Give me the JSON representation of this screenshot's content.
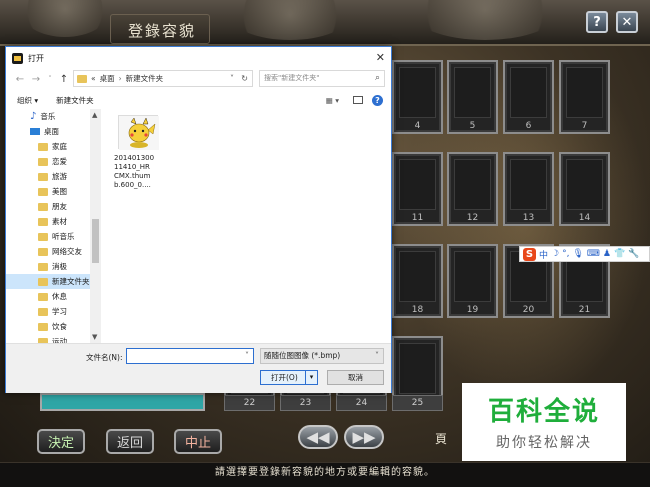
{
  "game": {
    "title": "登錄容貌",
    "help_icon_label": "?",
    "close_icon_label": "✕",
    "slot_numbers": [
      "4",
      "5",
      "6",
      "7",
      "11",
      "12",
      "13",
      "14",
      "18",
      "19",
      "20",
      "21"
    ],
    "bottom_slots": [
      "22",
      "23",
      "24",
      "25"
    ],
    "buttons": {
      "confirm": "決定",
      "back": "返回",
      "cancel": "中止"
    },
    "arrows": {
      "prev": "◀◀",
      "next": "▶▶"
    },
    "page_label": "頁",
    "status": "請選擇要登錄新容貌的地方或要編輯的容貌。"
  },
  "ime": {
    "logo": "S",
    "items": [
      "中",
      "☽",
      "°,",
      "🎙",
      "⌨",
      "♟",
      "👕",
      "🔧"
    ]
  },
  "watermark": {
    "title": "百科全说",
    "subtitle": "助你轻松解决"
  },
  "dialog": {
    "title": "打开",
    "close": "✕",
    "nav": {
      "back": "←",
      "forward": "→",
      "dropdown": "˅",
      "up": "↑"
    },
    "address": {
      "chevrons": "«",
      "crumb1": "桌面",
      "separator": "›",
      "crumb2": "新建文件夹",
      "dropdown": "˅",
      "refresh": "↻"
    },
    "search_placeholder": "搜索\"新建文件夹\"",
    "search_icon": "⌕",
    "toolbar": {
      "organize": "组织 ▾",
      "new_folder": "新建文件夹",
      "view": "▦ ▾",
      "help": "?"
    },
    "nav_items": [
      {
        "label": "音乐",
        "icon": "music"
      },
      {
        "label": "桌面",
        "icon": "desktop"
      },
      {
        "label": "家庭",
        "icon": "folder"
      },
      {
        "label": "恋爱",
        "icon": "folder"
      },
      {
        "label": "旅游",
        "icon": "folder"
      },
      {
        "label": "美图",
        "icon": "folder"
      },
      {
        "label": "朋友",
        "icon": "folder"
      },
      {
        "label": "素材",
        "icon": "folder"
      },
      {
        "label": "听音乐",
        "icon": "folder"
      },
      {
        "label": "网络交友",
        "icon": "folder"
      },
      {
        "label": "消极",
        "icon": "folder"
      },
      {
        "label": "新建文件夹",
        "icon": "folder"
      },
      {
        "label": "休息",
        "icon": "folder"
      },
      {
        "label": "学习",
        "icon": "folder"
      },
      {
        "label": "饮食",
        "icon": "folder"
      },
      {
        "label": "运动",
        "icon": "folder"
      }
    ],
    "file": {
      "name_line1": "201401300",
      "name_line2": "11410_HR",
      "name_line3": "CMX.thum",
      "name_line4": "b.600_0...."
    },
    "filename_label": "文件名(N):",
    "filename_value": "",
    "filetype": "随随位图图像 (*.bmp)",
    "open_button": "打开(O)",
    "open_split": "▾",
    "cancel_button": "取消"
  }
}
